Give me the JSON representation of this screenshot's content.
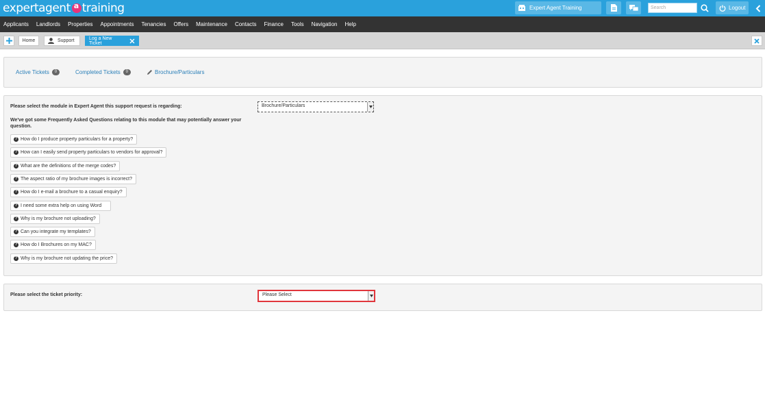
{
  "header": {
    "logo_text_1": "expertagent",
    "logo_text_2": "training",
    "branch_label": "Expert Agent Training",
    "search_placeholder": "Search",
    "logout_label": "Logout",
    "accent_color": "#2aa1dc",
    "logo_mark_color": "#e8357a"
  },
  "nav": {
    "items": [
      "Applicants",
      "Landlords",
      "Properties",
      "Appointments",
      "Tenancies",
      "Offers",
      "Maintenance",
      "Contacts",
      "Finance",
      "Tools",
      "Navigation",
      "Help"
    ]
  },
  "tabs": {
    "home": "Home",
    "support": "Support",
    "active": "Log a New Ticket"
  },
  "ticket_tabs": {
    "active_label": "Active Tickets",
    "active_count": "0",
    "completed_label": "Completed Tickets",
    "completed_count": "0",
    "current_label": "Brochure/Particulars"
  },
  "module": {
    "question": "Please select the module in Expert Agent this support request is regarding:",
    "selected": "Brochure/Particulars"
  },
  "faq": {
    "intro": "We've got some Frequently Asked Questions relating to this module that may potentially answer your question.",
    "items": [
      "How do I produce property particulars for a property?",
      "How can I easily send property particulars to vendors for approval?",
      "What are the definitions of the merge codes?",
      "The aspect ratio of my brochure images is incorrect?",
      "How do I e-mail a brochure to a casual enquiry?",
      "I need some extra help on using Word",
      "Why is my brochure not uploading?",
      "Can you integrate my templates?",
      "How do I Brochures on my MAC?",
      "Why is my brochure not updating the price?"
    ]
  },
  "priority": {
    "question": "Please select the ticket priority:",
    "selected": "Please Select",
    "highlight_color": "#e0353b"
  }
}
